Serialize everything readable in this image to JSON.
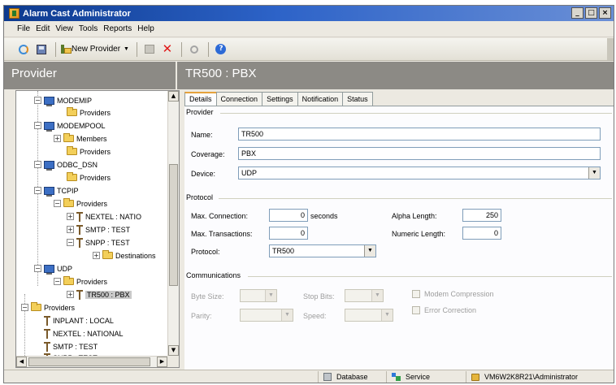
{
  "window": {
    "title": "Alarm Cast Administrator",
    "buttons": {
      "minimize": "_",
      "maximize": "□",
      "close": "×"
    }
  },
  "menu": [
    "File",
    "Edit",
    "View",
    "Tools",
    "Reports",
    "Help"
  ],
  "toolbar": {
    "new_provider_label": "New Provider",
    "icons": [
      "refresh-icon",
      "save-icon",
      "new-provider-icon",
      "edit-icon",
      "delete-icon",
      "find-icon",
      "help-icon"
    ]
  },
  "left_panel": {
    "title": "Provider"
  },
  "tree": {
    "modemip": "MODEMIP",
    "modemip_providers": "Providers",
    "modempool": "MODEMPOOL",
    "modempool_members": "Members",
    "modempool_providers": "Providers",
    "odbc_dsn": "ODBC_DSN",
    "odbc_providers": "Providers",
    "tcpip": "TCPIP",
    "tcpip_providers": "Providers",
    "nextel_natio": "NEXTEL : NATIO",
    "smtp_test": "SMTP : TEST",
    "snpp_test": "SNPP : TEST",
    "destinations": "Destinations",
    "udp": "UDP",
    "udp_providers": "Providers",
    "tr500_pbx": "TR500 : PBX",
    "providers_root": "Providers",
    "inplant_local": "INPLANT : LOCAL",
    "nextel_national": "NEXTEL : NATIONAL",
    "smtp_test2": "SMTP : TEST",
    "snpp_test2": "SNPP : TEST"
  },
  "right_panel": {
    "title": "TR500 : PBX"
  },
  "tabs": [
    "Details",
    "Connection",
    "Settings",
    "Notification",
    "Status"
  ],
  "details": {
    "provider_group": "Provider",
    "name_label": "Name:",
    "name_value": "TR500",
    "coverage_label": "Coverage:",
    "coverage_value": "PBX",
    "device_label": "Device:",
    "device_value": "UDP",
    "protocol_group": "Protocol",
    "max_connection_label": "Max. Connection:",
    "max_connection_value": "0",
    "seconds_label": "seconds",
    "max_transactions_label": "Max. Transactions:",
    "max_transactions_value": "0",
    "protocol_label": "Protocol:",
    "protocol_value": "TR500",
    "alpha_length_label": "Alpha Length:",
    "alpha_length_value": "250",
    "numeric_length_label": "Numeric Length:",
    "numeric_length_value": "0",
    "communications_group": "Communications",
    "byte_size_label": "Byte Size:",
    "stop_bits_label": "Stop Bits:",
    "parity_label": "Parity:",
    "speed_label": "Speed:",
    "modem_compression_label": "Modem Compression",
    "error_correction_label": "Error Correction"
  },
  "status": {
    "database": "Database",
    "service": "Service",
    "user": "VM6W2K8R21\\Administrator"
  }
}
